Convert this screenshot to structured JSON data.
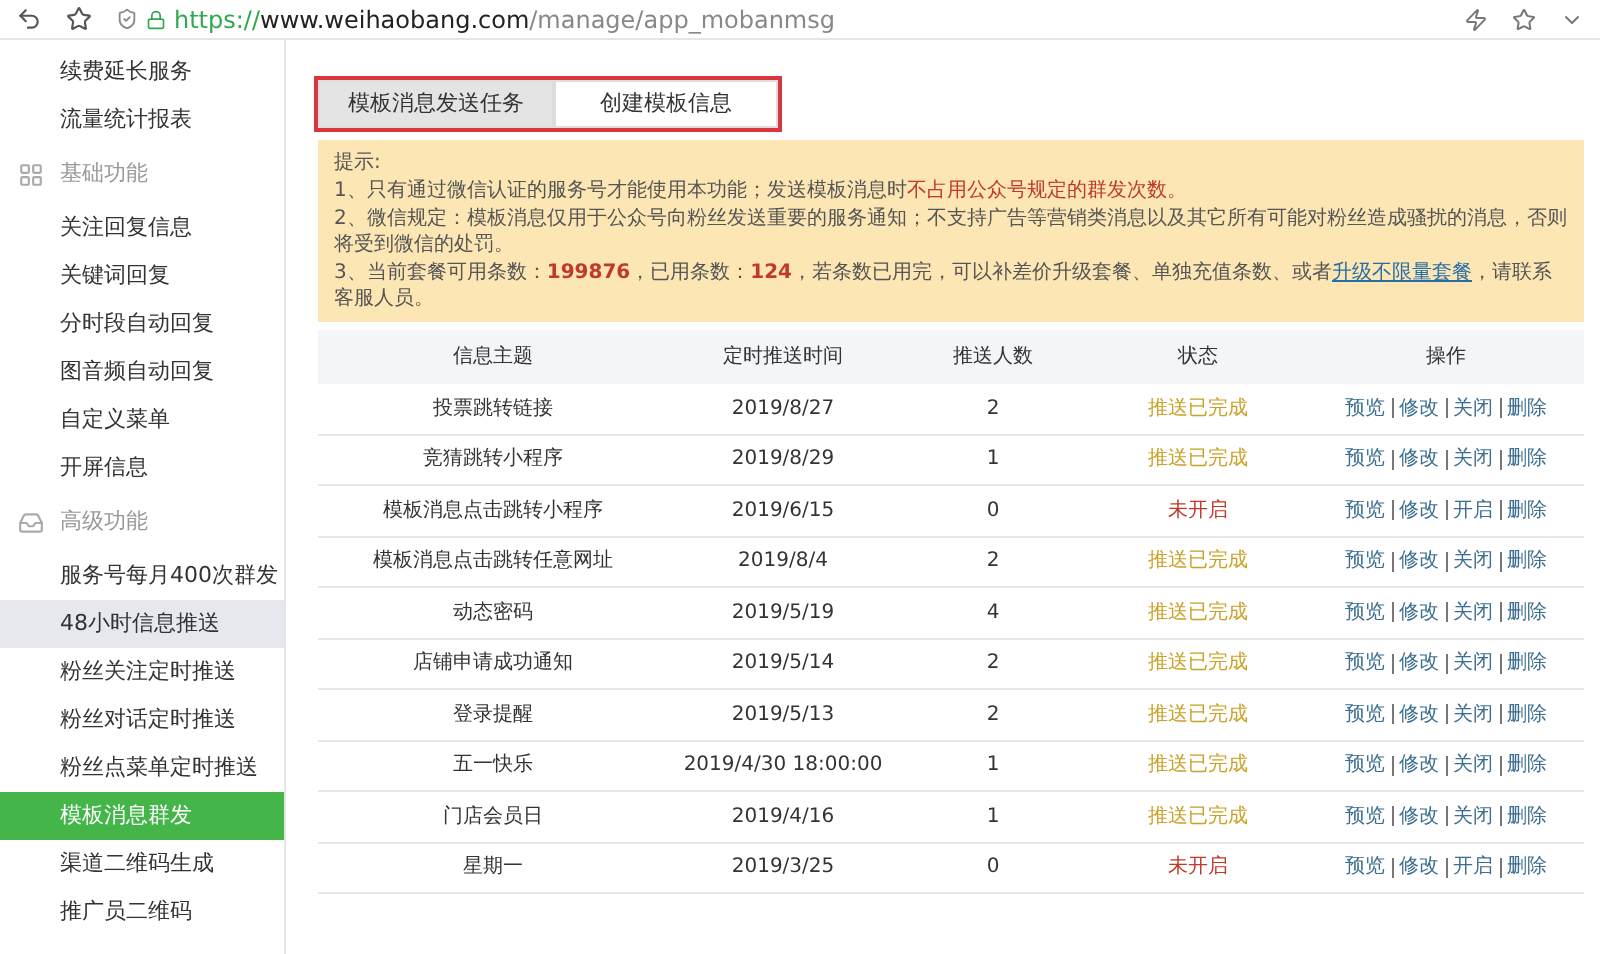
{
  "address_bar": {
    "scheme": "https://",
    "host": "www.weihaobang.com",
    "path": "/manage/app_mobanmsg"
  },
  "sidebar": {
    "items": [
      {
        "kind": "link",
        "label": "续费延长服务",
        "selected": false,
        "hovered": false
      },
      {
        "kind": "link",
        "label": "流量统计报表",
        "selected": false,
        "hovered": false
      },
      {
        "kind": "group",
        "label": "基础功能"
      },
      {
        "kind": "link",
        "label": "关注回复信息",
        "selected": false,
        "hovered": false
      },
      {
        "kind": "link",
        "label": "关键词回复",
        "selected": false,
        "hovered": false
      },
      {
        "kind": "link",
        "label": "分时段自动回复",
        "selected": false,
        "hovered": false
      },
      {
        "kind": "link",
        "label": "图音频自动回复",
        "selected": false,
        "hovered": false
      },
      {
        "kind": "link",
        "label": "自定义菜单",
        "selected": false,
        "hovered": false
      },
      {
        "kind": "link",
        "label": "开屏信息",
        "selected": false,
        "hovered": false
      },
      {
        "kind": "group",
        "label": "高级功能"
      },
      {
        "kind": "link",
        "label": "服务号每月400次群发",
        "selected": false,
        "hovered": false
      },
      {
        "kind": "link",
        "label": "48小时信息推送",
        "selected": false,
        "hovered": true
      },
      {
        "kind": "link",
        "label": "粉丝关注定时推送",
        "selected": false,
        "hovered": false
      },
      {
        "kind": "link",
        "label": "粉丝对话定时推送",
        "selected": false,
        "hovered": false
      },
      {
        "kind": "link",
        "label": "粉丝点菜单定时推送",
        "selected": false,
        "hovered": false
      },
      {
        "kind": "link",
        "label": "模板消息群发",
        "selected": true,
        "hovered": false
      },
      {
        "kind": "link",
        "label": "渠道二维码生成",
        "selected": false,
        "hovered": false
      },
      {
        "kind": "link",
        "label": "推广员二维码",
        "selected": false,
        "hovered": false
      }
    ]
  },
  "tabs": [
    {
      "label": "模板消息发送任务",
      "selected": true
    },
    {
      "label": "创建模板信息",
      "selected": false
    }
  ],
  "notice": {
    "title": "提示:",
    "lines": [
      [
        {
          "kind": "plain",
          "text": "1、只有通过微信认证的服务号才能使用本功能；发送模板消息时"
        },
        {
          "kind": "alert",
          "text": "不占用公众号规定的群发次数。"
        }
      ],
      [
        {
          "kind": "plain",
          "text": "2、微信规定：模板消息仅用于公众号向粉丝发送重要的服务通知；不支持广告等营销类消息以及其它所有可能对粉丝造成骚扰的消息，否则将受到微信的处罚。"
        }
      ],
      [
        {
          "kind": "plain",
          "text": "3、当前套餐可用条数："
        },
        {
          "kind": "number",
          "text": "199876"
        },
        {
          "kind": "plain",
          "text": "，已用条数："
        },
        {
          "kind": "number",
          "text": "124"
        },
        {
          "kind": "plain",
          "text": "，若条数已用完，可以补差价升级套餐、单独充值条数、或者"
        },
        {
          "kind": "link",
          "text": "升级不限量套餐"
        },
        {
          "kind": "plain",
          "text": "，请联系客服人员。"
        }
      ]
    ]
  },
  "table": {
    "columns": [
      "信息主题",
      "定时推送时间",
      "推送人数",
      "状态",
      "操作"
    ],
    "rows": [
      {
        "subject": "投票跳转链接",
        "time": "2019/8/27",
        "count": "2",
        "status": {
          "kind": "done",
          "text": "推送已完成"
        },
        "actions": [
          "预览",
          "修改",
          "关闭",
          "删除"
        ]
      },
      {
        "subject": "竞猜跳转小程序",
        "time": "2019/8/29",
        "count": "1",
        "status": {
          "kind": "done",
          "text": "推送已完成"
        },
        "actions": [
          "预览",
          "修改",
          "关闭",
          "删除"
        ]
      },
      {
        "subject": "模板消息点击跳转小程序",
        "time": "2019/6/15",
        "count": "0",
        "status": {
          "kind": "off",
          "text": "未开启"
        },
        "actions": [
          "预览",
          "修改",
          "开启",
          "删除"
        ]
      },
      {
        "subject": "模板消息点击跳转任意网址",
        "time": "2019/8/4",
        "count": "2",
        "status": {
          "kind": "done",
          "text": "推送已完成"
        },
        "actions": [
          "预览",
          "修改",
          "关闭",
          "删除"
        ]
      },
      {
        "subject": "动态密码",
        "time": "2019/5/19",
        "count": "4",
        "status": {
          "kind": "done",
          "text": "推送已完成"
        },
        "actions": [
          "预览",
          "修改",
          "关闭",
          "删除"
        ]
      },
      {
        "subject": "店铺申请成功通知",
        "time": "2019/5/14",
        "count": "2",
        "status": {
          "kind": "done",
          "text": "推送已完成"
        },
        "actions": [
          "预览",
          "修改",
          "关闭",
          "删除"
        ]
      },
      {
        "subject": "登录提醒",
        "time": "2019/5/13",
        "count": "2",
        "status": {
          "kind": "done",
          "text": "推送已完成"
        },
        "actions": [
          "预览",
          "修改",
          "关闭",
          "删除"
        ]
      },
      {
        "subject": "五一快乐",
        "time": "2019/4/30 18:00:00",
        "count": "1",
        "status": {
          "kind": "done",
          "text": "推送已完成"
        },
        "actions": [
          "预览",
          "修改",
          "关闭",
          "删除"
        ]
      },
      {
        "subject": "门店会员日",
        "time": "2019/4/16",
        "count": "1",
        "status": {
          "kind": "done",
          "text": "推送已完成"
        },
        "actions": [
          "预览",
          "修改",
          "关闭",
          "删除"
        ]
      },
      {
        "subject": "星期一",
        "time": "2019/3/25",
        "count": "0",
        "status": {
          "kind": "off",
          "text": "未开启"
        },
        "actions": [
          "预览",
          "修改",
          "开启",
          "删除"
        ]
      }
    ]
  }
}
